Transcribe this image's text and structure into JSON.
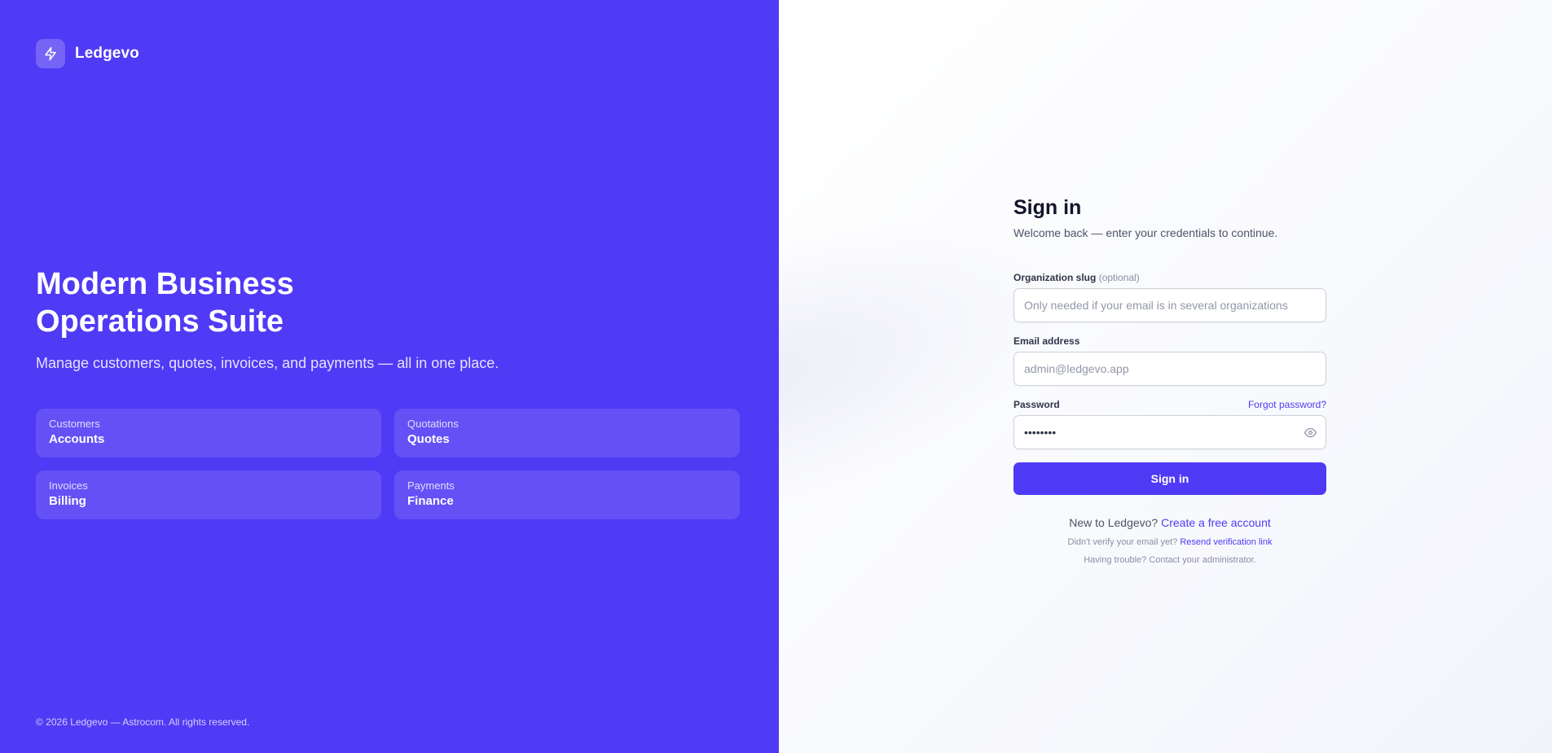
{
  "brand": {
    "name": "Ledgevo",
    "icon": "lightning-icon"
  },
  "hero": {
    "title": "Modern Business\nOperations Suite",
    "subtitle": "Manage customers, quotes, invoices, and payments — all in one place."
  },
  "features": [
    {
      "caption": "Customers",
      "title": "Accounts"
    },
    {
      "caption": "Quotations",
      "title": "Quotes"
    },
    {
      "caption": "Invoices",
      "title": "Billing"
    },
    {
      "caption": "Payments",
      "title": "Finance"
    }
  ],
  "footer": {
    "copyright": "© 2026 Ledgevo — Astrocom. All rights reserved."
  },
  "signin": {
    "title": "Sign in",
    "subtitle": "Welcome back — enter your credentials to continue.",
    "org": {
      "label": "Organization slug",
      "optional": "(optional)",
      "placeholder": "Only needed if your email is in several organizations",
      "value": ""
    },
    "email": {
      "label": "Email address",
      "placeholder": "admin@ledgevo.app",
      "value": ""
    },
    "password": {
      "label": "Password",
      "forgot": "Forgot password?",
      "value": "••••••••",
      "toggle_icon": "eye-icon"
    },
    "submit": "Sign in",
    "new_user": {
      "text": "New to Ledgevo?",
      "link": "Create a free account"
    },
    "verify": {
      "text": "Didn't verify your email yet?",
      "link": "Resend verification link"
    },
    "trouble": "Having trouble? Contact your administrator."
  },
  "colors": {
    "primary": "#4f3af5",
    "text_dark": "#14142b",
    "text_muted": "#4e5468"
  }
}
